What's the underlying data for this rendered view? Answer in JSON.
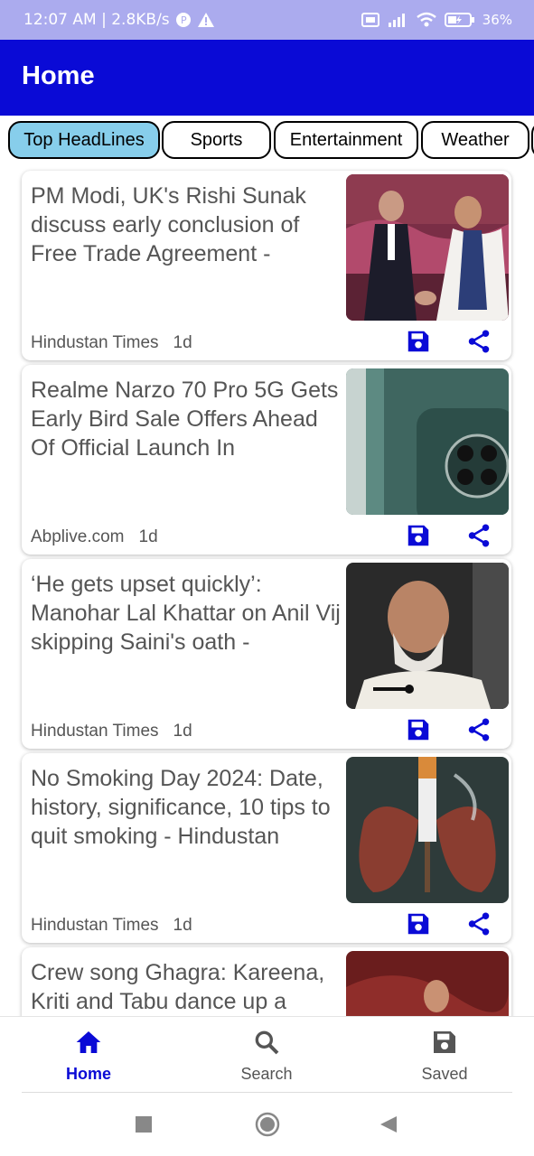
{
  "status": {
    "time_speed": "12:07 AM | 2.8KB/s",
    "battery": "36%"
  },
  "appbar": {
    "title": "Home"
  },
  "tabs": [
    "Top HeadLines",
    "Sports",
    "Entertainment",
    "Weather"
  ],
  "articles": [
    {
      "title": "PM Modi, UK's Rishi Sunak discuss early conclusion of Free Trade Agreement -",
      "source": "Hindustan Times",
      "age": "1d"
    },
    {
      "title": "Realme Narzo 70 Pro 5G Gets Early Bird Sale Offers Ahead Of Official Launch In",
      "source": "Abplive.com",
      "age": "1d"
    },
    {
      "title": "‘He gets upset quickly’: Manohar Lal Khattar on Anil Vij skipping Saini's oath -",
      "source": "Hindustan Times",
      "age": "1d"
    },
    {
      "title": "No Smoking Day 2024: Date, history, significance, 10 tips to quit smoking - Hindustan",
      "source": "Hindustan Times",
      "age": "1d"
    },
    {
      "title": "Crew song Ghagra: Kareena, Kriti and Tabu dance up a",
      "source": "",
      "age": ""
    }
  ],
  "bottom_nav": {
    "home": "Home",
    "search": "Search",
    "saved": "Saved"
  },
  "colors": {
    "primary": "#0a0ad6",
    "status_bar": "#ababee",
    "active_tab": "#87ceeb"
  }
}
